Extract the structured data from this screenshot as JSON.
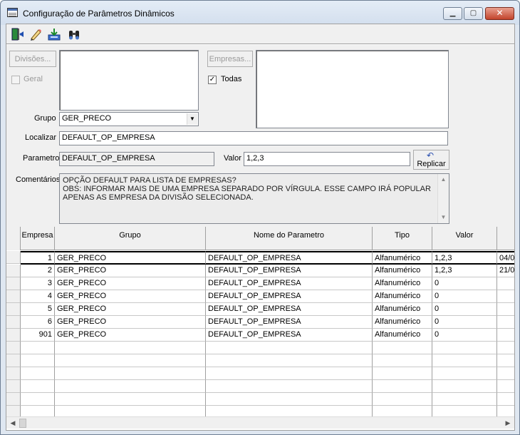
{
  "window": {
    "title": "Configuração de Parâmetros Dinâmicos"
  },
  "toolbar": {
    "icons": [
      "exit-icon",
      "edit-icon",
      "import-icon",
      "find-icon"
    ]
  },
  "filters": {
    "divisoes_button": "Divisões...",
    "geral_label": "Geral",
    "geral_checked": false,
    "empresas_button": "Empresas...",
    "todas_label": "Todas",
    "todas_checked": true,
    "todas_check_glyph": "✓",
    "grupo_label": "Grupo",
    "grupo_value": "GER_PRECO",
    "localizar_label": "Localizar",
    "localizar_value": "DEFAULT_OP_EMPRESA",
    "parametro_label": "Parametro",
    "parametro_value": "DEFAULT_OP_EMPRESA",
    "valor_label": "Valor",
    "valor_value": "1,2,3",
    "replicar_button": "Replicar",
    "comentarios_label": "Comentários",
    "comentarios_lines": [
      "OPÇÃO DEFAULT PARA LISTA DE EMPRESAS?",
      "OBS: INFORMAR MAIS DE UMA EMPRESA SEPARADO POR VÍRGULA. ESSE CAMPO IRÁ POPULAR",
      "APENAS AS EMPRESA DA DIVISÃO SELECIONADA."
    ]
  },
  "grid": {
    "columns": [
      "Empresa",
      "Grupo",
      "Nome do Parametro",
      "Tipo",
      "Valor",
      ""
    ],
    "rows": [
      [
        "1",
        "GER_PRECO",
        "DEFAULT_OP_EMPRESA",
        "Alfanumérico",
        "1,2,3",
        "04/0"
      ],
      [
        "2",
        "GER_PRECO",
        "DEFAULT_OP_EMPRESA",
        "Alfanumérico",
        "1,2,3",
        "21/0"
      ],
      [
        "3",
        "GER_PRECO",
        "DEFAULT_OP_EMPRESA",
        "Alfanumérico",
        "0",
        ""
      ],
      [
        "4",
        "GER_PRECO",
        "DEFAULT_OP_EMPRESA",
        "Alfanumérico",
        "0",
        ""
      ],
      [
        "5",
        "GER_PRECO",
        "DEFAULT_OP_EMPRESA",
        "Alfanumérico",
        "0",
        ""
      ],
      [
        "6",
        "GER_PRECO",
        "DEFAULT_OP_EMPRESA",
        "Alfanumérico",
        "0",
        ""
      ],
      [
        "901",
        "GER_PRECO",
        "DEFAULT_OP_EMPRESA",
        "Alfanumérico",
        "0",
        ""
      ]
    ],
    "empty_rows": 6,
    "selected_row": 0
  },
  "colors": {
    "title_bg": "#dfe7f1",
    "close_red": "#c2432b"
  }
}
